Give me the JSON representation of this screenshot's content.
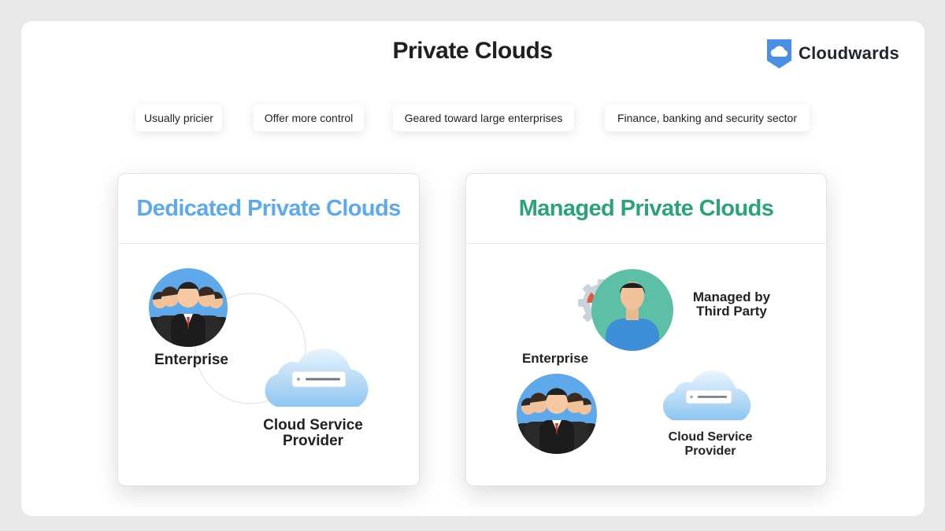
{
  "header": {
    "title": "Private Clouds",
    "brand": "Cloudwards"
  },
  "features": [
    "Usually pricier",
    "Offer more control",
    "Geared toward large enterprises",
    "Finance, banking and security sector"
  ],
  "dedicated": {
    "title": "Dedicated Private Clouds",
    "enterprise_label": "Enterprise",
    "provider_label_line1": "Cloud Service",
    "provider_label_line2": "Provider"
  },
  "managed": {
    "title": "Managed Private Clouds",
    "third_party_line1": "Managed by",
    "third_party_line2": "Third Party",
    "enterprise_label": "Enterprise",
    "provider_label_line1": "Cloud Service",
    "provider_label_line2": "Provider"
  },
  "colors": {
    "dedicated_title": "#5ea9ea",
    "managed_title": "#2aa37a",
    "brand": "#4a90e2"
  }
}
